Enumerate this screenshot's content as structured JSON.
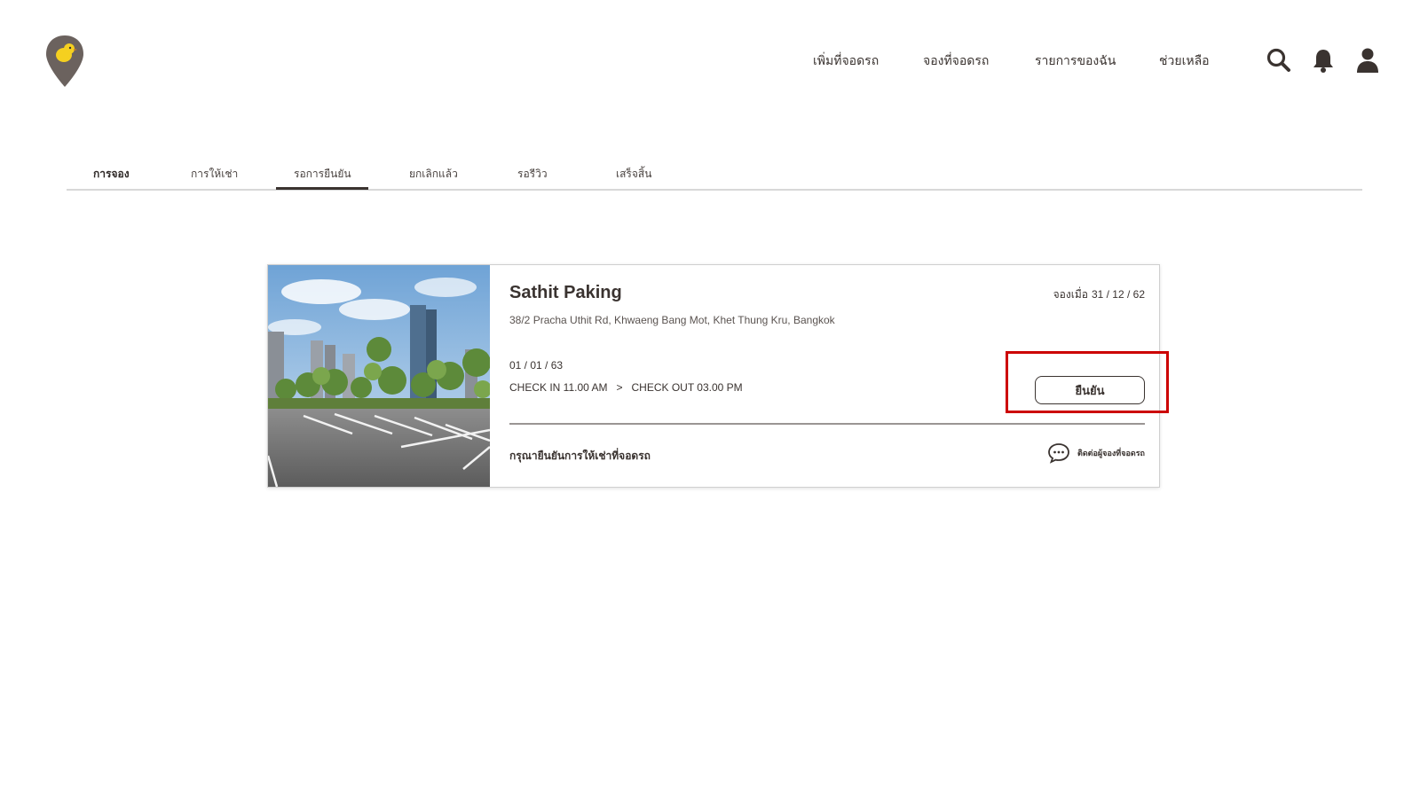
{
  "nav": {
    "items": [
      {
        "label": "เพิ่มที่จอดรถ"
      },
      {
        "label": "จองที่จอดรถ"
      },
      {
        "label": "รายการของฉัน"
      },
      {
        "label": "ช่วยเหลือ"
      }
    ],
    "icons": [
      "search-icon",
      "bell-icon",
      "user-icon"
    ]
  },
  "logo": {
    "icon": "map-pin-chick-logo"
  },
  "tabs": {
    "items": [
      {
        "label": "การจอง"
      },
      {
        "label": "การให้เช่า"
      },
      {
        "label": "รอการยืนยัน"
      },
      {
        "label": "ยกเลิกแล้ว"
      },
      {
        "label": "รอรีวิว"
      },
      {
        "label": "เสร็จสิ้น"
      }
    ],
    "active": "รอการยืนยัน"
  },
  "booking": {
    "name": "Sathit Paking",
    "address": "38/2 Pracha Uthit Rd, Khwaeng Bang Mot, Khet Thung Kru, Bangkok",
    "booked_on_label": "จองเมื่อ",
    "booked_on_date": "31 / 12 / 62",
    "date": "01 / 01 / 63",
    "check_in": "CHECK IN  11.00 AM",
    "arrow": ">",
    "check_out": "CHECK OUT  03.00 PM",
    "confirm_label": "ยืนยัน",
    "note": "กรุณายืนยันการให้เช่าที่จอดรถ",
    "contact_label": "ติดต่อผู้จองที่จอดรถ"
  },
  "colors": {
    "text": "#3a3330",
    "highlight": "#cc0000",
    "logo_pin": "#6b625e",
    "logo_chick": "#f5d020"
  }
}
